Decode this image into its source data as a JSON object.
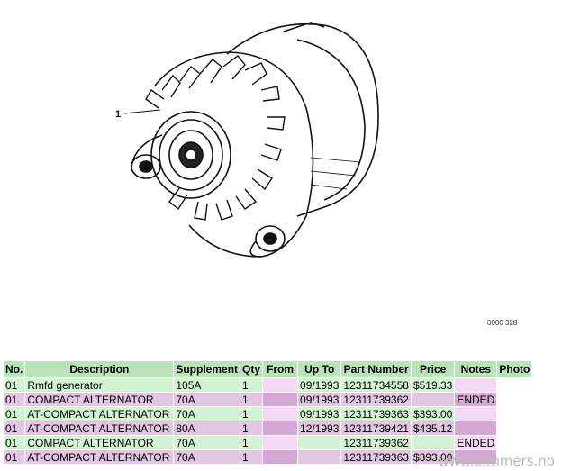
{
  "diagram": {
    "callout_label": "1",
    "diagram_code": "0000 328"
  },
  "table": {
    "headers": [
      "No.",
      "Description",
      "Supplement",
      "Qty",
      "From",
      "Up To",
      "Part Number",
      "Price",
      "Notes",
      "Photo"
    ],
    "rows": [
      {
        "no": "01",
        "description": "Rmfd generator",
        "supplement": "105A",
        "qty": "1",
        "from": "",
        "upto": "09/1993",
        "part_number": "12311734558",
        "price": "$519.33",
        "notes": "",
        "photo": ""
      },
      {
        "no": "01",
        "description": "COMPACT ALTERNATOR",
        "supplement": "70A",
        "qty": "1",
        "from": "",
        "upto": "09/1993",
        "part_number": "12311739362",
        "price": "",
        "notes": "ENDED",
        "photo": ""
      },
      {
        "no": "01",
        "description": "AT-COMPACT ALTERNATOR",
        "supplement": "70A",
        "qty": "1",
        "from": "",
        "upto": "09/1993",
        "part_number": "12311739363",
        "price": "$393.00",
        "notes": "",
        "photo": ""
      },
      {
        "no": "01",
        "description": "AT-COMPACT ALTERNATOR",
        "supplement": "80A",
        "qty": "1",
        "from": "",
        "upto": "12/1993",
        "part_number": "12311739421",
        "price": "$435.12",
        "notes": "",
        "photo": ""
      },
      {
        "no": "01",
        "description": "COMPACT ALTERNATOR",
        "supplement": "70A",
        "qty": "1",
        "from": "",
        "upto": "",
        "part_number": "12311739362",
        "price": "",
        "notes": "ENDED",
        "photo": ""
      },
      {
        "no": "01",
        "description": "AT-COMPACT ALTERNATOR",
        "supplement": "70A",
        "qty": "1",
        "from": "",
        "upto": "",
        "part_number": "12311739363",
        "price": "$393.00",
        "notes": "",
        "photo": ""
      }
    ]
  },
  "watermark": "www.bimmers.no"
}
